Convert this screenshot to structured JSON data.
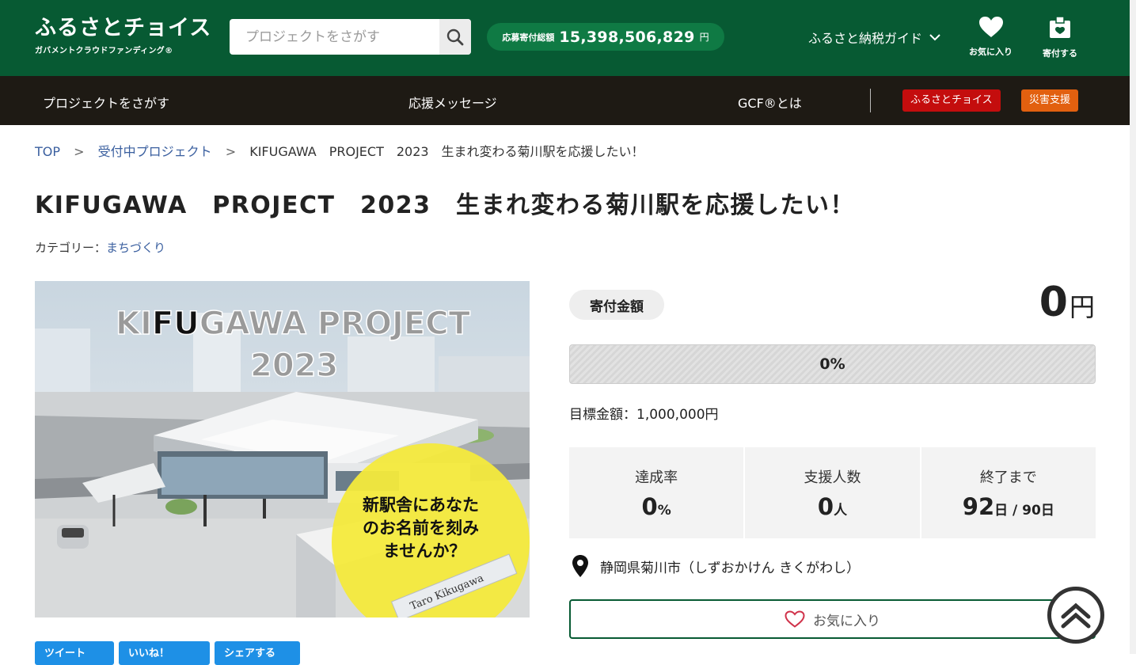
{
  "header": {
    "logo_main": "ふるさとチョイス",
    "logo_sub": "ガバメントクラウドファンディング®",
    "search_placeholder": "プロジェクトをさがす",
    "total_label": "応募寄付総額",
    "total_value": "15,398,506,829",
    "total_unit": "円",
    "guide_label": "ふるさと納税ガイド",
    "favorites_label": "お気に入り",
    "donate_label": "寄付する"
  },
  "nav": {
    "items": [
      "プロジェクトをさがす",
      "応援メッセージ",
      "GCF®とは"
    ],
    "badge_choice": "ふるさとチョイス",
    "badge_disaster": "災害支援"
  },
  "breadcrumb": {
    "top": "TOP",
    "list": "受付中プロジェクト",
    "current": "KIFUGAWA　PROJECT　2023　生まれ変わる菊川駅を応援したい！",
    "sep": ">"
  },
  "project": {
    "title": "KIFUGAWA　PROJECT　2023　生まれ変わる菊川駅を応援したい！",
    "category_label": "カテゴリー：",
    "category_value": "まちづくり"
  },
  "hero": {
    "headline_a": "KI",
    "headline_b": "FU",
    "headline_c": "GAWA PROJECT",
    "headline_year": "2023",
    "bubble_line1": "新駅舎にあなた",
    "bubble_line2": "のお名前を刻み",
    "bubble_line3": "ませんか？",
    "plate_text": "Taro Kikugawa"
  },
  "share": [
    "ツイート",
    "いいね！",
    "シェアする"
  ],
  "funding": {
    "amount_label": "寄付金額",
    "amount_value": "0",
    "amount_unit": "円",
    "progress_percent": 0,
    "progress_text": "0%",
    "goal_text": "目標金額：1,000,000円",
    "stats": [
      {
        "label": "達成率",
        "value": "0",
        "unit": "%"
      },
      {
        "label": "支援人数",
        "value": "0",
        "unit": "人"
      },
      {
        "label": "終了まで",
        "value": "92",
        "unit": "日 / 90日"
      }
    ],
    "location": "静岡県菊川市（しずおかけん きくがわし）",
    "favorite_label": "お気に入り"
  },
  "colors": {
    "header_green": "#075a33",
    "nav_dark": "#1e1a14",
    "badge_red": "#c40d0d",
    "badge_orange": "#e2600f"
  }
}
